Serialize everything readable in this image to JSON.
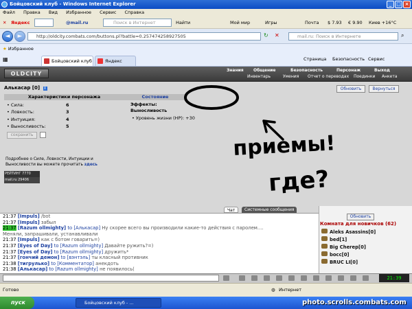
{
  "window": {
    "title": "Бойцовский клуб - Windows Internet Explorer"
  },
  "menu": [
    "Файл",
    "Правка",
    "Вид",
    "Избранное",
    "Сервис",
    "Справка"
  ],
  "toolbar": {
    "yandex_label": "Яндекс",
    "mailru_label": "@mail.ru",
    "search_placeholder": "Поиск в Интернет",
    "find_label": "Найти",
    "moimir_label": "Мой мир",
    "games_label": "Игры",
    "mail_label": "Почта",
    "usd_rate": "$ 7.93",
    "eur_rate": "€ 9.90",
    "weather": "Киев +16°C"
  },
  "address": {
    "url": "http://oldcity.combats.com/buttons.pl?battle=0.257474258927505",
    "mail_search_placeholder": "mail.ru: Поиск в Интернете"
  },
  "favorites": {
    "label": "Избранное"
  },
  "tabs": [
    {
      "label": "Бойцовский клуб"
    },
    {
      "label": "Яндекс"
    }
  ],
  "ie_tools": [
    "Страница",
    "Безопасность",
    "Сервис"
  ],
  "game": {
    "logo": "OLDCITY",
    "nav": [
      "Знания",
      "Общение",
      "Безопасность",
      "Персонаж",
      "Выход"
    ],
    "subnav": [
      "Инвентарь",
      "Умения",
      "Отчет о переводах",
      "Поединки",
      "Анкета"
    ],
    "refresh_button": "Обновить",
    "return_button": "Вернуться",
    "character": {
      "name": "Алькасар",
      "level": "[0]",
      "info_icon": "i"
    },
    "stats_header": "Характеристики персонажа",
    "stats": [
      {
        "label": "Сила:",
        "value": "6"
      },
      {
        "label": "Ловкость:",
        "value": "3"
      },
      {
        "label": "Интуиция:",
        "value": "4"
      },
      {
        "label": "Выносливость:",
        "value": "5"
      }
    ],
    "save_button": "сохранить",
    "more_info_text": "Подробнее о Силе, Ловкости, Интуиции и Выносливости вы можете прочитать",
    "more_info_link": "здесь",
    "counter1": "РЕЙТИНГ 7770 16697",
    "counter2": "mail.ru 29406",
    "state_header": "Состояние",
    "effects_label": "Эффекты:",
    "endurance_label": "Выносливость",
    "hp_line": "Уровень жизни (HP): +30"
  },
  "annotation": {
    "line1": "приемы!",
    "line2": "где?"
  },
  "chat": {
    "tabs": [
      "Чат",
      "Системные сообщения"
    ],
    "lines": [
      {
        "time": "21:37",
        "nick": "[Impuls]",
        "to": "",
        "text": " /bot"
      },
      {
        "time": "21:37",
        "nick": "[Impuls]",
        "to": "",
        "text": " забыл"
      },
      {
        "time": "21:37",
        "nick": "[Razum ollmighty]",
        "to": " to [Алькасар]",
        "text": " Ну скорее всего вы производили какие-то действия с паролем...."
      },
      {
        "time": "",
        "nick": "",
        "to": "",
        "text": "Меняли, запрашивали, устанавливали"
      },
      {
        "time": "21:37",
        "nick": "[Impuls]",
        "to": "",
        "text": " как с ботом говарить=)"
      },
      {
        "time": "21:37",
        "nick": "[Eyes of Day]",
        "to": " to [Razum ollmighty]",
        "text": " Давайте ружить?=)"
      },
      {
        "time": "21:37",
        "nick": "[Eyes of Day]",
        "to": " to [Razum ollmighty]",
        "text": " дружить*"
      },
      {
        "time": "21:37",
        "nick": "[гончий демон]",
        "to": " to [вэнтэль]",
        "text": " ты класный противник"
      },
      {
        "time": "21:38",
        "nick": "[тигрулько]",
        "to": " to [Комментатор]",
        "text": " анекдоть"
      },
      {
        "time": "21:38",
        "nick": "[Алькасар]",
        "to": " to [Razum ollmighty]",
        "text": " не появилось("
      }
    ]
  },
  "room": {
    "refresh_button": "Обновить",
    "title": "Комната для новичков (62)",
    "users": [
      "Aleks Asassins[0]",
      "bed[1]",
      "Big Cherep[0]",
      "bocc[0]",
      "BRUC LI[0]"
    ]
  },
  "clock": "21:39",
  "status": {
    "left": "Готово",
    "zone": "Интернет"
  },
  "taskbar": {
    "start": "пуск",
    "task": "Бойцовский клуб - ..."
  },
  "watermark": "photo.scrolls.combats.com"
}
